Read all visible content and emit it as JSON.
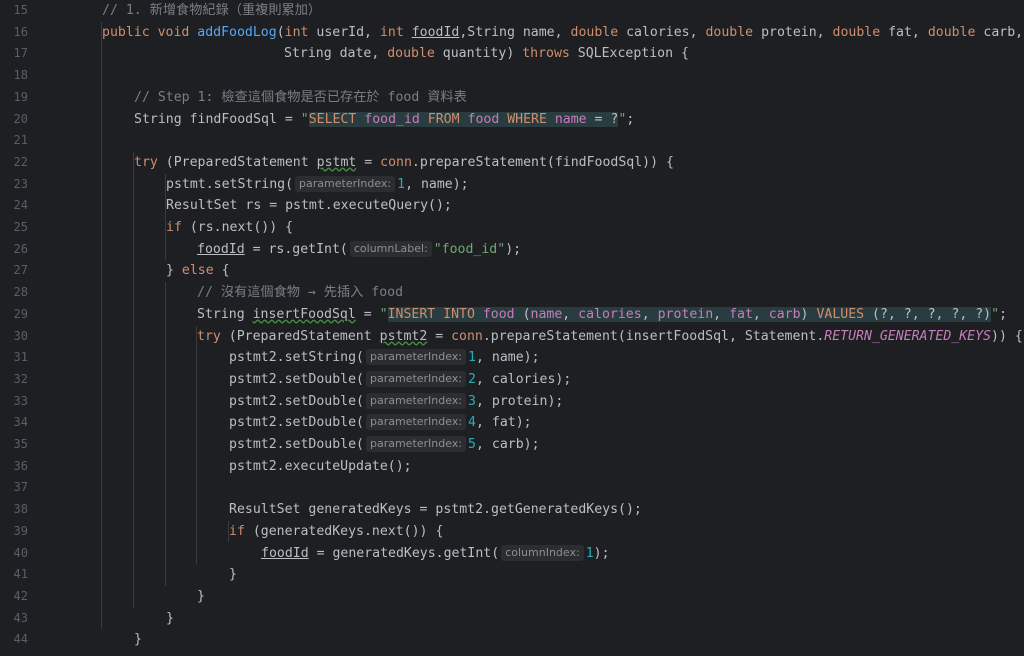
{
  "lines": [
    {
      "n": "15",
      "parts": [
        {
          "c": "cm",
          "t": "// 1. 新增食物紀錄（重複則累加）"
        }
      ]
    },
    {
      "n": "16",
      "parts": [
        {
          "c": "kw",
          "t": "public void "
        },
        {
          "c": "fn",
          "t": "addFoodLog"
        },
        {
          "c": "",
          "t": "("
        },
        {
          "c": "kw",
          "t": "int "
        },
        {
          "c": "",
          "t": "userId, "
        },
        {
          "c": "kw",
          "t": "int "
        },
        {
          "c": "ul",
          "t": "foodId"
        },
        {
          "c": "",
          "t": ",String name, "
        },
        {
          "c": "kw",
          "t": "double "
        },
        {
          "c": "",
          "t": "calories, "
        },
        {
          "c": "kw",
          "t": "double "
        },
        {
          "c": "",
          "t": "protein, "
        },
        {
          "c": "kw",
          "t": "double "
        },
        {
          "c": "",
          "t": "fat, "
        },
        {
          "c": "kw",
          "t": "double "
        },
        {
          "c": "",
          "t": "carb,"
        }
      ]
    },
    {
      "n": "17",
      "parts": [
        {
          "c": "",
          "t": "String date, "
        },
        {
          "c": "kw",
          "t": "double "
        },
        {
          "c": "",
          "t": "quantity) "
        },
        {
          "c": "kw",
          "t": "throws "
        },
        {
          "c": "",
          "t": "SQLException {"
        }
      ]
    },
    {
      "n": "18",
      "parts": []
    },
    {
      "n": "19",
      "parts": [
        {
          "c": "cm",
          "t": "// Step 1: 檢查這個食物是否已存在於 food 資料表"
        }
      ]
    },
    {
      "n": "20",
      "parts": [
        {
          "c": "",
          "t": "String findFoodSql = "
        },
        {
          "c": "str",
          "t": "\""
        },
        {
          "c": "sqlbg sqlkw",
          "t": "SELECT "
        },
        {
          "c": "sqlbg sqlid",
          "t": "food_id "
        },
        {
          "c": "sqlbg sqlkw",
          "t": "FROM "
        },
        {
          "c": "sqlbg sqlid",
          "t": "food "
        },
        {
          "c": "sqlbg sqlkw",
          "t": "WHERE "
        },
        {
          "c": "sqlbg sqlid",
          "t": "name "
        },
        {
          "c": "sqlbg",
          "t": "= ?"
        },
        {
          "c": "str",
          "t": "\""
        },
        {
          "c": "",
          "t": ";"
        }
      ]
    },
    {
      "n": "21",
      "parts": []
    },
    {
      "n": "22",
      "parts": [
        {
          "c": "kw",
          "t": "try "
        },
        {
          "c": "",
          "t": "(PreparedStatement "
        },
        {
          "c": "wav",
          "t": "pstmt"
        },
        {
          "c": "",
          "t": " = "
        },
        {
          "c": "kw",
          "t": "conn"
        },
        {
          "c": "",
          "t": ".prepareStatement(findFoodSql)) {"
        }
      ]
    },
    {
      "n": "23",
      "parts": [
        {
          "c": "",
          "t": "pstmt.setString("
        },
        {
          "c": "hint",
          "t": "parameterIndex:"
        },
        {
          "c": "num",
          "t": "1"
        },
        {
          "c": "",
          "t": ", name);"
        }
      ]
    },
    {
      "n": "24",
      "parts": [
        {
          "c": "",
          "t": "ResultSet rs = pstmt.executeQuery();"
        }
      ]
    },
    {
      "n": "25",
      "parts": [
        {
          "c": "kw",
          "t": "if "
        },
        {
          "c": "",
          "t": "(rs.next()) {"
        }
      ]
    },
    {
      "n": "26",
      "parts": [
        {
          "c": "ul",
          "t": "foodId"
        },
        {
          "c": "",
          "t": " = rs.getInt("
        },
        {
          "c": "hint",
          "t": "columnLabel:"
        },
        {
          "c": "str",
          "t": "\"food_id\""
        },
        {
          "c": "",
          "t": ");"
        }
      ]
    },
    {
      "n": "27",
      "parts": [
        {
          "c": "",
          "t": "} "
        },
        {
          "c": "kw",
          "t": "else "
        },
        {
          "c": "",
          "t": "{"
        }
      ]
    },
    {
      "n": "28",
      "parts": [
        {
          "c": "cm",
          "t": "// 沒有這個食物 → 先插入 food"
        }
      ]
    },
    {
      "n": "29",
      "parts": [
        {
          "c": "",
          "t": "String "
        },
        {
          "c": "wav",
          "t": "insertFoodSql"
        },
        {
          "c": "",
          "t": " = "
        },
        {
          "c": "str",
          "t": "\""
        },
        {
          "c": "sqlbg sqlkw",
          "t": "INSERT INTO "
        },
        {
          "c": "sqlbg sqlid",
          "t": "food "
        },
        {
          "c": "sqlbg",
          "t": "("
        },
        {
          "c": "sqlbg sqlid",
          "t": "name"
        },
        {
          "c": "sqlbg",
          "t": ", "
        },
        {
          "c": "sqlbg sqlid",
          "t": "calories"
        },
        {
          "c": "sqlbg",
          "t": ", "
        },
        {
          "c": "sqlbg sqlid",
          "t": "protein"
        },
        {
          "c": "sqlbg",
          "t": ", "
        },
        {
          "c": "sqlbg sqlid",
          "t": "fat"
        },
        {
          "c": "sqlbg",
          "t": ", "
        },
        {
          "c": "sqlbg sqlid",
          "t": "carb"
        },
        {
          "c": "sqlbg",
          "t": ") "
        },
        {
          "c": "sqlbg sqlkw",
          "t": "VALUES "
        },
        {
          "c": "sqlbg",
          "t": "(?, ?, ?, ?, ?)"
        },
        {
          "c": "str",
          "t": "\""
        },
        {
          "c": "",
          "t": ";"
        }
      ]
    },
    {
      "n": "30",
      "parts": [
        {
          "c": "kw",
          "t": "try "
        },
        {
          "c": "",
          "t": "(PreparedStatement "
        },
        {
          "c": "wav",
          "t": "pstmt2"
        },
        {
          "c": "",
          "t": " = "
        },
        {
          "c": "kw",
          "t": "conn"
        },
        {
          "c": "",
          "t": ".prepareStatement(insertFoodSql, Statement."
        },
        {
          "c": "st",
          "t": "RETURN_GENERATED_KEYS"
        },
        {
          "c": "",
          "t": ")) {"
        }
      ]
    },
    {
      "n": "31",
      "parts": [
        {
          "c": "",
          "t": "pstmt2.setString("
        },
        {
          "c": "hint",
          "t": "parameterIndex:"
        },
        {
          "c": "num",
          "t": "1"
        },
        {
          "c": "",
          "t": ", name);"
        }
      ]
    },
    {
      "n": "32",
      "parts": [
        {
          "c": "",
          "t": "pstmt2.setDouble("
        },
        {
          "c": "hint",
          "t": "parameterIndex:"
        },
        {
          "c": "num",
          "t": "2"
        },
        {
          "c": "",
          "t": ", calories);"
        }
      ]
    },
    {
      "n": "33",
      "parts": [
        {
          "c": "",
          "t": "pstmt2.setDouble("
        },
        {
          "c": "hint",
          "t": "parameterIndex:"
        },
        {
          "c": "num",
          "t": "3"
        },
        {
          "c": "",
          "t": ", protein);"
        }
      ]
    },
    {
      "n": "34",
      "parts": [
        {
          "c": "",
          "t": "pstmt2.setDouble("
        },
        {
          "c": "hint",
          "t": "parameterIndex:"
        },
        {
          "c": "num",
          "t": "4"
        },
        {
          "c": "",
          "t": ", fat);"
        }
      ]
    },
    {
      "n": "35",
      "parts": [
        {
          "c": "",
          "t": "pstmt2.setDouble("
        },
        {
          "c": "hint",
          "t": "parameterIndex:"
        },
        {
          "c": "num",
          "t": "5"
        },
        {
          "c": "",
          "t": ", carb);"
        }
      ]
    },
    {
      "n": "36",
      "parts": [
        {
          "c": "",
          "t": "pstmt2.executeUpdate();"
        }
      ]
    },
    {
      "n": "37",
      "parts": []
    },
    {
      "n": "38",
      "parts": [
        {
          "c": "",
          "t": "ResultSet generatedKeys = pstmt2.getGeneratedKeys();"
        }
      ]
    },
    {
      "n": "39",
      "parts": [
        {
          "c": "kw",
          "t": "if "
        },
        {
          "c": "",
          "t": "(generatedKeys.next()) {"
        }
      ]
    },
    {
      "n": "40",
      "parts": [
        {
          "c": "ul",
          "t": "foodId"
        },
        {
          "c": "",
          "t": " = generatedKeys.getInt("
        },
        {
          "c": "hint",
          "t": "columnIndex:"
        },
        {
          "c": "num",
          "t": "1"
        },
        {
          "c": "",
          "t": ");"
        }
      ]
    },
    {
      "n": "41",
      "parts": [
        {
          "c": "",
          "t": "}"
        }
      ]
    },
    {
      "n": "42",
      "parts": [
        {
          "c": "",
          "t": "}"
        }
      ]
    },
    {
      "n": "43",
      "parts": [
        {
          "c": "",
          "t": "}"
        }
      ]
    },
    {
      "n": "44",
      "parts": [
        {
          "c": "",
          "t": "}"
        }
      ]
    }
  ]
}
